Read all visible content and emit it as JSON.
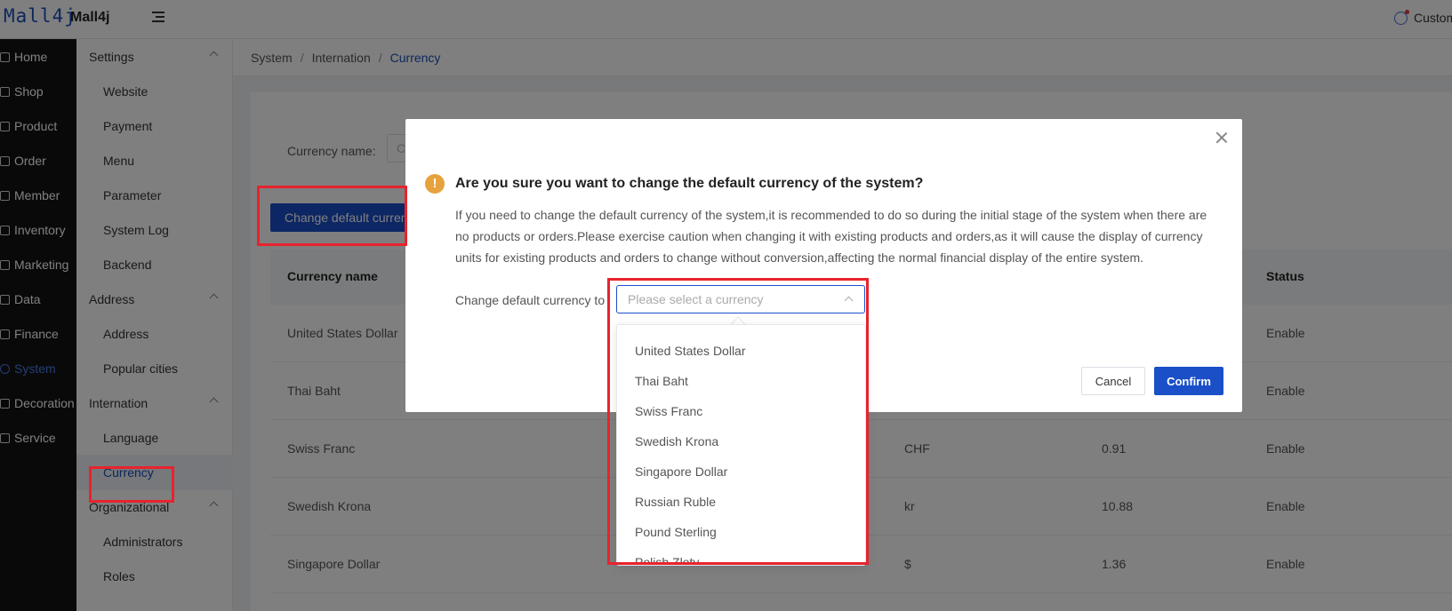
{
  "header": {
    "logo_text": "Mall4j",
    "app_name": "Mall4j",
    "customer_label": "Custom"
  },
  "nav": {
    "items": [
      {
        "label": "Home",
        "icon": "home-icon"
      },
      {
        "label": "Shop",
        "icon": "shop-icon"
      },
      {
        "label": "Product",
        "icon": "product-icon"
      },
      {
        "label": "Order",
        "icon": "order-icon"
      },
      {
        "label": "Member",
        "icon": "member-icon"
      },
      {
        "label": "Inventory",
        "icon": "inventory-icon"
      },
      {
        "label": "Marketing",
        "icon": "marketing-icon"
      },
      {
        "label": "Data",
        "icon": "data-icon"
      },
      {
        "label": "Finance",
        "icon": "finance-icon"
      },
      {
        "label": "System",
        "icon": "system-icon",
        "active": true
      },
      {
        "label": "Decoration",
        "icon": "decoration-icon"
      },
      {
        "label": "Service",
        "icon": "service-icon"
      }
    ]
  },
  "subnav": {
    "groups": [
      {
        "label": "Settings",
        "items": [
          "Website",
          "Payment",
          "Menu",
          "Parameter",
          "System Log",
          "Backend"
        ]
      },
      {
        "label": "Address",
        "items": [
          "Address",
          "Popular cities"
        ]
      },
      {
        "label": "Internation",
        "items": [
          "Language",
          "Currency"
        ]
      },
      {
        "label": "Organizational",
        "items": [
          "Administrators",
          "Roles"
        ]
      }
    ],
    "active_item": "Currency"
  },
  "breadcrumb": [
    "System",
    "Internation",
    "Currency"
  ],
  "page": {
    "search_label": "Currency name:",
    "search_placeholder": "C",
    "change_button": "Change default currency",
    "columns": {
      "name": "Currency name",
      "status": "Status"
    },
    "rows": [
      {
        "name": "United States Dollar",
        "symbol": "",
        "rate": "",
        "status": "Enable"
      },
      {
        "name": "Thai Baht",
        "symbol": "",
        "rate": "",
        "status": "Enable"
      },
      {
        "name": "Swiss Franc",
        "symbol": "CHF",
        "rate": "0.91",
        "status": "Enable"
      },
      {
        "name": "Swedish Krona",
        "symbol": "kr",
        "rate": "10.88",
        "status": "Enable"
      },
      {
        "name": "Singapore Dollar",
        "symbol": "$",
        "rate": "1.36",
        "status": "Enable"
      }
    ]
  },
  "dialog": {
    "title": "Are you sure you want to change the default currency of the system?",
    "message": "If you need to change the default currency of the system,it is recommended to do so during the initial stage of the system when there are no products or orders.Please exercise caution when changing it with existing products and orders,as it will cause the display of currency units for existing products and orders to change without conversion,affecting the normal financial display of the entire system.",
    "field_label": "Change default currency to",
    "select_placeholder": "Please select a currency",
    "cancel_label": "Cancel",
    "confirm_label": "Confirm"
  },
  "dropdown": {
    "options": [
      "United States Dollar",
      "Thai Baht",
      "Swiss Franc",
      "Swedish Krona",
      "Singapore Dollar",
      "Russian Ruble",
      "Pound Sterling",
      "Polish Zloty"
    ]
  },
  "colors": {
    "primary": "#1a4fc8",
    "warning": "#e6a23c",
    "highlight": "#e8232d",
    "sidebar_bg": "#121212"
  }
}
